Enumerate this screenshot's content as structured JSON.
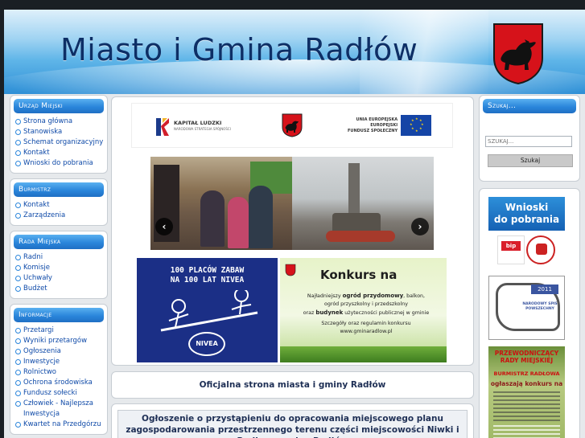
{
  "header": {
    "title": "Miasto i Gmina Radłów",
    "crest_icon": "wolf-crest-icon"
  },
  "sidebar_left": {
    "sections": [
      {
        "title": "Urząd Miejski",
        "items": [
          "Strona główna",
          "Stanowiska",
          "Schemat organizacyjny",
          "Kontakt",
          "Wnioski do pobrania"
        ]
      },
      {
        "title": "Burmistrz",
        "items": [
          "Kontakt",
          "Zarządzenia"
        ]
      },
      {
        "title": "Rada Miejska",
        "items": [
          "Radni",
          "Komisje",
          "Uchwały",
          "Budżet"
        ]
      },
      {
        "title": "Informacje",
        "items": [
          "Przetargi",
          "Wyniki przetargów",
          "Ogłoszenia",
          "Inwestycje",
          "Rolnictwo",
          "Ochrona środowiska",
          "Fundusz sołecki",
          "Człowiek - Najlepsza Inwestycja",
          "Kwartet na Przedgórzu"
        ]
      }
    ]
  },
  "main": {
    "eu_banner": {
      "kapital_title": "KAPITAŁ LUDZKI",
      "kapital_sub": "NARODOWA STRATEGIA SPÓJNOŚCI",
      "eu_line1": "UNIA EUROPEJSKA",
      "eu_line2": "EUROPEJSKI",
      "eu_line3": "FUNDUSZ SPOŁECZNY"
    },
    "slider": {
      "prev_label": "‹",
      "next_label": "›"
    },
    "nivea_banner": {
      "title_line1": "100 PLACÓW ZABAW",
      "title_line2": "NA 100 LAT NIVEA",
      "logo": "NIVEA"
    },
    "konkurs_banner": {
      "heading": "Konkurs na",
      "line1_pre": "Najładniejszy ",
      "line1_bold": "ogród przydomowy",
      "line1_post": ", balkon,",
      "line2": "ogród przyszkolny i przedszkolny",
      "line3_pre": "oraz ",
      "line3_bold": "budynek",
      "line3_post": " użyteczności publicznej w gminie",
      "line4": "Szczegóły oraz regulamin konkursu",
      "url": "www.gminaradlow.pl"
    },
    "official_title": "Oficjalna strona miasta i gminy Radłów",
    "announcement": "Ogłoszenie o przystąpieniu do opracowania miejscowego planu zagospodarowania przestrzennego terenu części miejscowości Niwki i Radłowa gmina Radłów"
  },
  "sidebar_right": {
    "search_title": "Szukaj...",
    "search_placeholder": "SZUKAJ...",
    "search_button": "Szukaj",
    "wnioski_line1": "Wnioski",
    "wnioski_line2": "do pobrania",
    "bip_label": "bip",
    "nsp_year": "2011",
    "nsp_text": "NARODOWY SPIS POWSZECHNY",
    "przew_head_line1": "PRZEWODNICZĄCY",
    "przew_head_line2": "RADY MIEJSKIEJ",
    "przew_sub": "BURMISTRZ RADŁOWA",
    "przew_ann": "ogłaszają konkurs na"
  },
  "colors": {
    "accent": "#2b86db",
    "link": "#0f4aa8",
    "title": "#0d2f66",
    "crest_red": "#d6121a"
  }
}
